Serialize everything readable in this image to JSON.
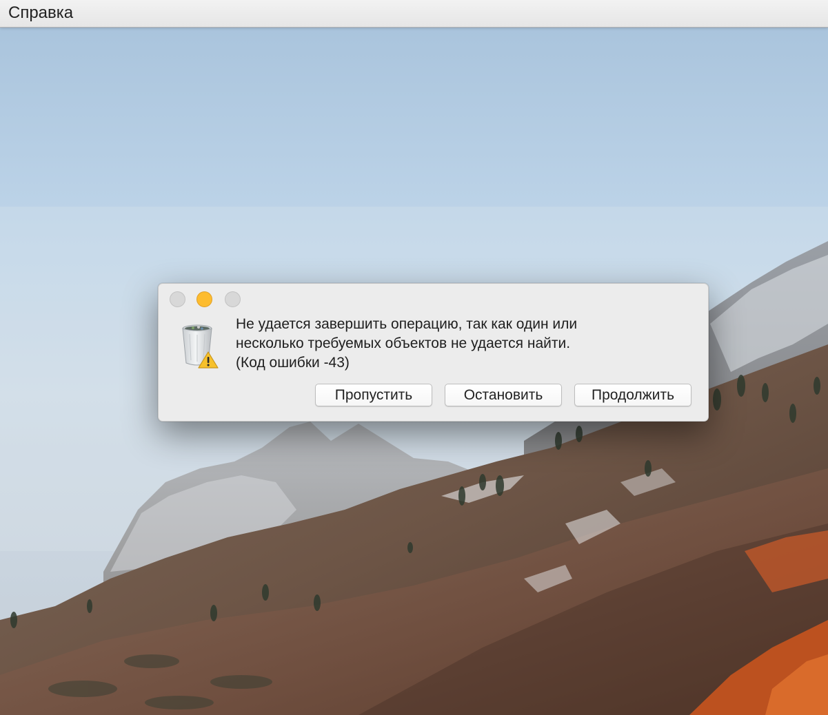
{
  "menubar": {
    "items": [
      "Справка"
    ]
  },
  "dialog": {
    "message_lines": [
      "Не удается завершить операцию, так как один или",
      "несколько требуемых объектов не удается найти.",
      "(Код ошибки -43)"
    ],
    "icon": "trash-warning-icon",
    "buttons": {
      "skip": "Пропустить",
      "stop": "Остановить",
      "continue": "Продолжить"
    }
  },
  "colors": {
    "minimize_button": "#fdbc2f",
    "traffic_inactive": "#d8d8d8",
    "dialog_background": "#ececec"
  }
}
